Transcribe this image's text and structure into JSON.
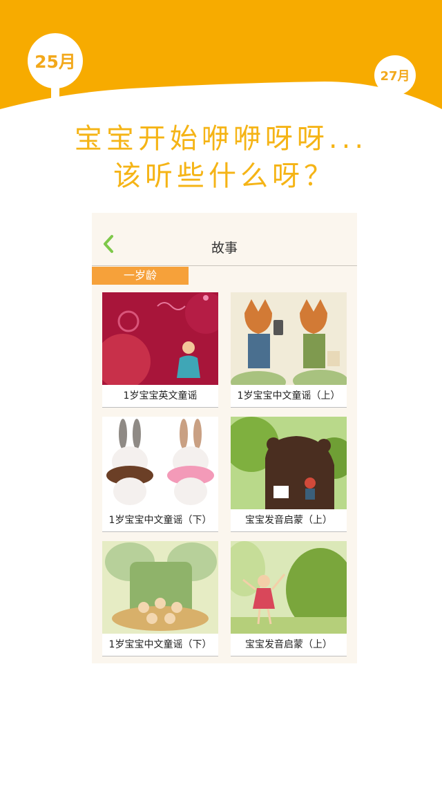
{
  "header": {
    "month_left": "25月",
    "month_right": "27月",
    "accent_color": "#f7ab00"
  },
  "headline": {
    "line1": "宝宝开始咿咿呀呀...",
    "line2": "该听些什么呀？"
  },
  "screen": {
    "nav_title": "故事",
    "back_icon": "chevron-left-icon",
    "age_tag": "一岁龄",
    "cards": [
      {
        "caption": "1岁宝宝英文童谣",
        "art": "red-child-illustration"
      },
      {
        "caption": "1岁宝宝中文童谣（上）",
        "art": "two-foxes-illustration"
      },
      {
        "caption": "1岁宝宝中文童谣（下）",
        "art": "rabbits-donuts-illustration"
      },
      {
        "caption": "宝宝发音启蒙（上）",
        "art": "bear-forest-illustration"
      },
      {
        "caption": "1岁宝宝中文童谣（下）",
        "art": "tree-house-children-illustration"
      },
      {
        "caption": "宝宝发音启蒙（上）",
        "art": "girl-in-garden-illustration"
      }
    ]
  }
}
